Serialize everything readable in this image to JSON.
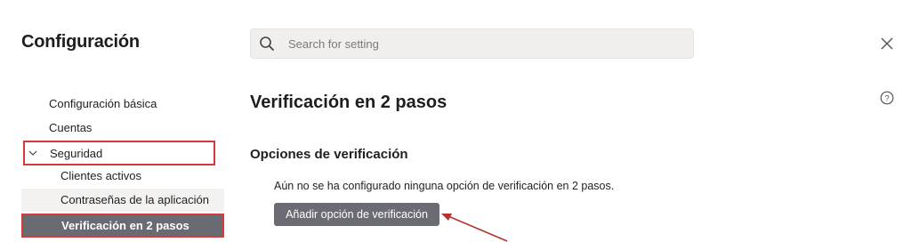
{
  "window": {
    "title": "Configuración"
  },
  "search": {
    "placeholder": "Search for setting",
    "value": ""
  },
  "icons": {
    "search": "search-icon",
    "close": "close-icon",
    "help": "help-icon",
    "chevron": "chevron-down-icon"
  },
  "sidebar": {
    "items": [
      {
        "label": "Configuración básica"
      },
      {
        "label": "Cuentas"
      },
      {
        "label": "Seguridad",
        "expanded": true,
        "highlighted": true
      },
      {
        "label": "Clientes activos"
      },
      {
        "label": "Contraseñas de la aplicación"
      },
      {
        "label": "Verificación en 2 pasos",
        "selected": true,
        "highlighted": true
      }
    ]
  },
  "main": {
    "title": "Verificación en 2 pasos",
    "section_title": "Opciones de verificación",
    "info": "Aún no se ha configurado ninguna opción de verificación en 2 pasos.",
    "add_button_label": "Añadir opción de verificación"
  },
  "colors": {
    "highlight_border": "#d43a3a",
    "selected_bg": "#6a6a72",
    "button_bg": "#6b6b73",
    "search_bg": "#f1efed",
    "annotation_arrow": "#b5322e"
  }
}
